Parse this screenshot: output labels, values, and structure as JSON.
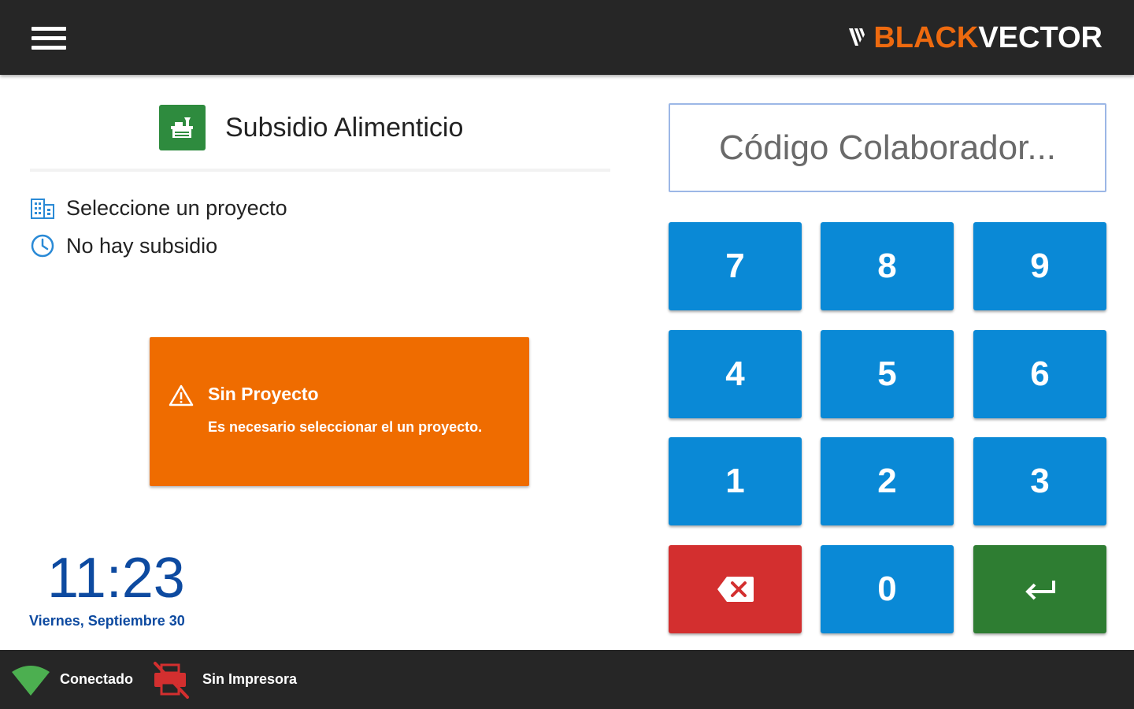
{
  "header": {
    "menu_icon": "hamburger-menu-icon",
    "logo": {
      "black": "BLACK",
      "vector": "VECTOR"
    }
  },
  "main": {
    "app_title": "Subsidio Alimenticio",
    "app_icon": "food-tray-icon",
    "project_label": "Seleccione un proyecto",
    "project_icon": "building-icon",
    "subsidy_label": "No hay subsidio",
    "subsidy_icon": "clock-icon"
  },
  "alert": {
    "icon": "warning-icon",
    "title": "Sin Proyecto",
    "message": "Es necesario seleccionar el un proyecto.",
    "color": "#ef6c00"
  },
  "clock": {
    "time": "11:23",
    "date": "Viernes, Septiembre 30"
  },
  "keypad": {
    "placeholder": "Código Colaborador...",
    "keys": [
      "7",
      "8",
      "9",
      "4",
      "5",
      "6",
      "1",
      "2",
      "3",
      "0"
    ],
    "backspace_icon": "backspace-icon",
    "enter_icon": "enter-icon",
    "colors": {
      "digit": "#0a89d6",
      "backspace": "#d32f2f",
      "enter": "#2e7d32"
    }
  },
  "footer": {
    "wifi_icon": "wifi-icon",
    "wifi_label": "Conectado",
    "printer_icon": "printer-off-icon",
    "printer_label": "Sin Impresora"
  }
}
